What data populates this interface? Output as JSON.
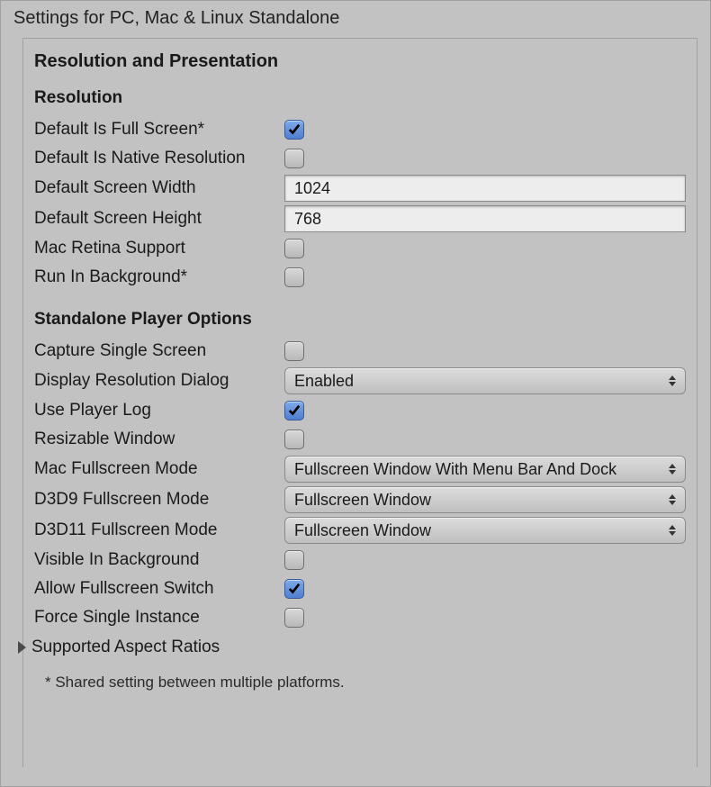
{
  "panel": {
    "title": "Settings for PC, Mac & Linux Standalone"
  },
  "section": {
    "title": "Resolution and Presentation"
  },
  "resolution": {
    "title": "Resolution",
    "defaultFullScreen": {
      "label": "Default Is Full Screen*",
      "checked": true
    },
    "defaultNativeRes": {
      "label": "Default Is Native Resolution",
      "checked": false
    },
    "defaultWidth": {
      "label": "Default Screen Width",
      "value": "1024"
    },
    "defaultHeight": {
      "label": "Default Screen Height",
      "value": "768"
    },
    "macRetina": {
      "label": "Mac Retina Support",
      "checked": false
    },
    "runBackground": {
      "label": "Run In Background*",
      "checked": false
    }
  },
  "player": {
    "title": "Standalone Player Options",
    "captureSingle": {
      "label": "Capture Single Screen",
      "checked": false
    },
    "displayResDialog": {
      "label": "Display Resolution Dialog",
      "value": "Enabled"
    },
    "usePlayerLog": {
      "label": "Use Player Log",
      "checked": true
    },
    "resizable": {
      "label": "Resizable Window",
      "checked": false
    },
    "macFullscreen": {
      "label": "Mac Fullscreen Mode",
      "value": "Fullscreen Window With Menu Bar And Dock"
    },
    "d3d9": {
      "label": "D3D9 Fullscreen Mode",
      "value": "Fullscreen Window"
    },
    "d3d11": {
      "label": "D3D11 Fullscreen Mode",
      "value": "Fullscreen Window"
    },
    "visibleBg": {
      "label": "Visible In Background",
      "checked": false
    },
    "allowSwitch": {
      "label": "Allow Fullscreen Switch",
      "checked": true
    },
    "forceSingle": {
      "label": "Force Single Instance",
      "checked": false
    },
    "aspectFoldout": {
      "label": "Supported Aspect Ratios",
      "expanded": false
    }
  },
  "footnote": "* Shared setting between multiple platforms."
}
